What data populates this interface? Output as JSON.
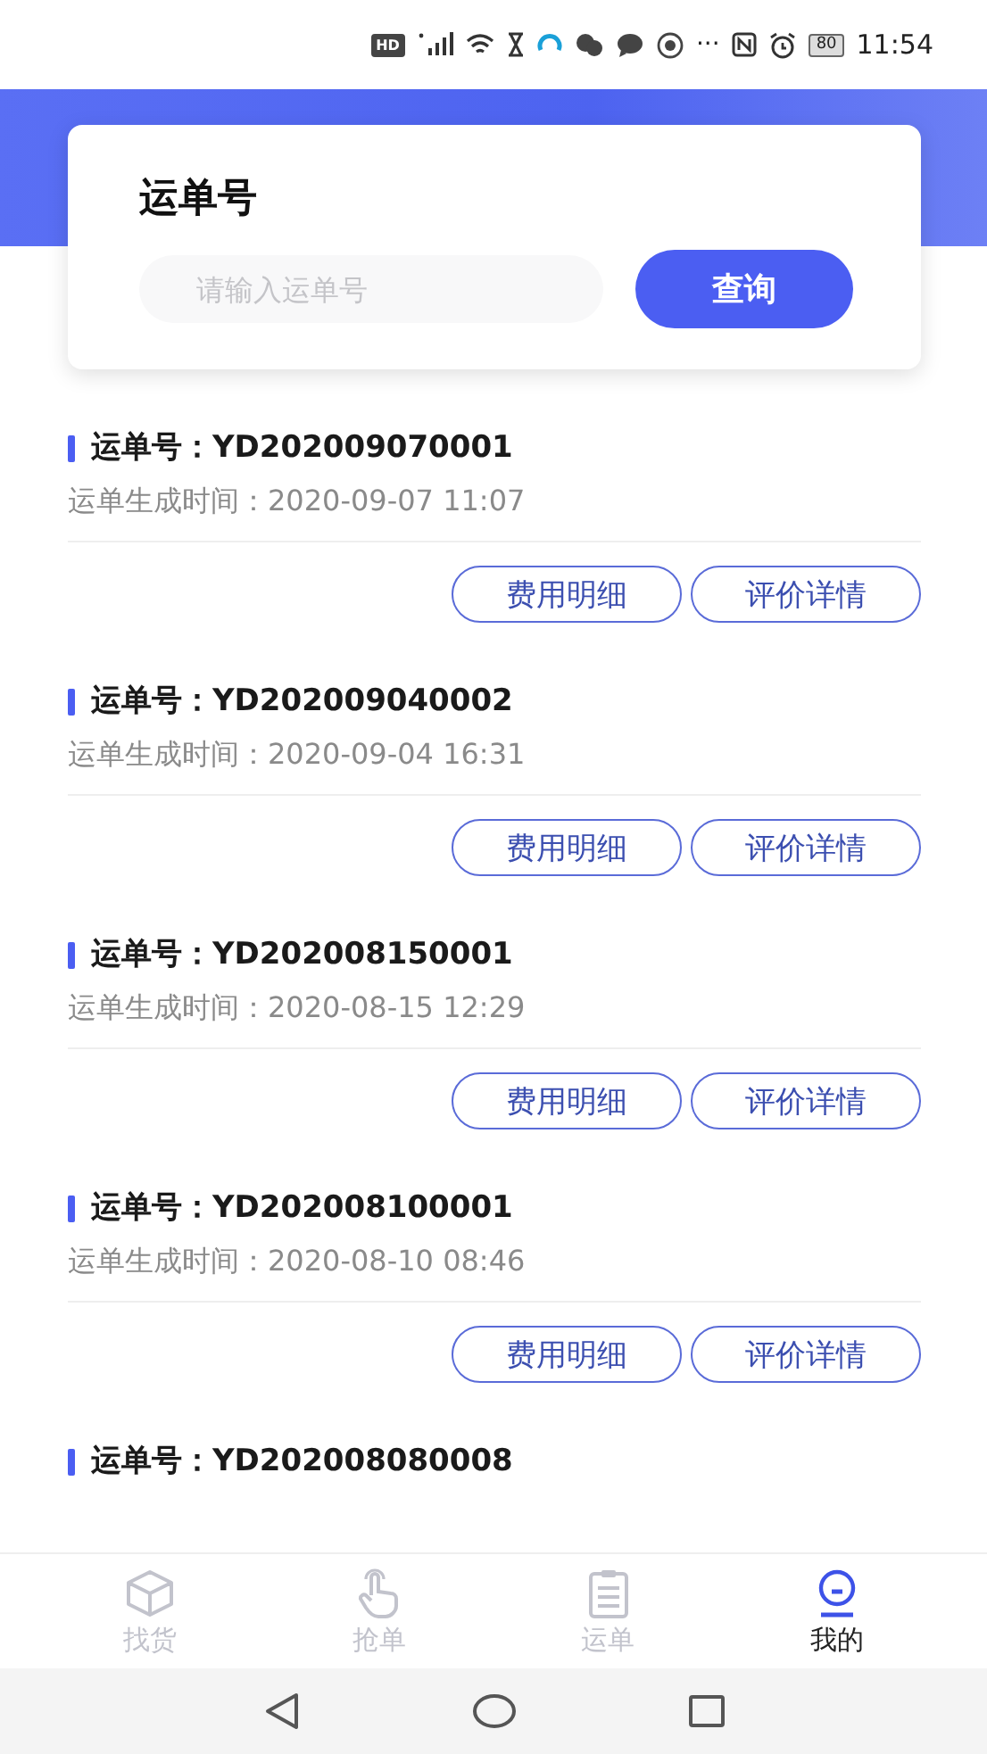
{
  "status_bar": {
    "hd": "HD",
    "more": "···",
    "battery": "80",
    "time": "11:54"
  },
  "search": {
    "title": "运单号",
    "placeholder": "请输入运单号",
    "button": "查询"
  },
  "orders": [
    {
      "number": "运单号：YD202009070001",
      "time": "运单生成时间：2020-09-07 11:07",
      "actions": [
        "费用明细",
        "评价详情"
      ]
    },
    {
      "number": "运单号：YD202009040002",
      "time": "运单生成时间：2020-09-04 16:31",
      "actions": [
        "费用明细",
        "评价详情"
      ]
    },
    {
      "number": "运单号：YD202008150001",
      "time": "运单生成时间：2020-08-15 12:29",
      "actions": [
        "费用明细",
        "评价详情"
      ]
    },
    {
      "number": "运单号：YD202008100001",
      "time": "运单生成时间：2020-08-10 08:46",
      "actions": [
        "费用明细",
        "评价详情"
      ]
    },
    {
      "number": "运单号：YD202008080008"
    }
  ],
  "tabs": [
    {
      "kind": "box",
      "label": "找货",
      "selected": false
    },
    {
      "kind": "hand",
      "label": "抢单",
      "selected": false
    },
    {
      "kind": "clipboard",
      "label": "运单",
      "selected": false
    },
    {
      "kind": "person",
      "label": "我的",
      "selected": true
    }
  ]
}
